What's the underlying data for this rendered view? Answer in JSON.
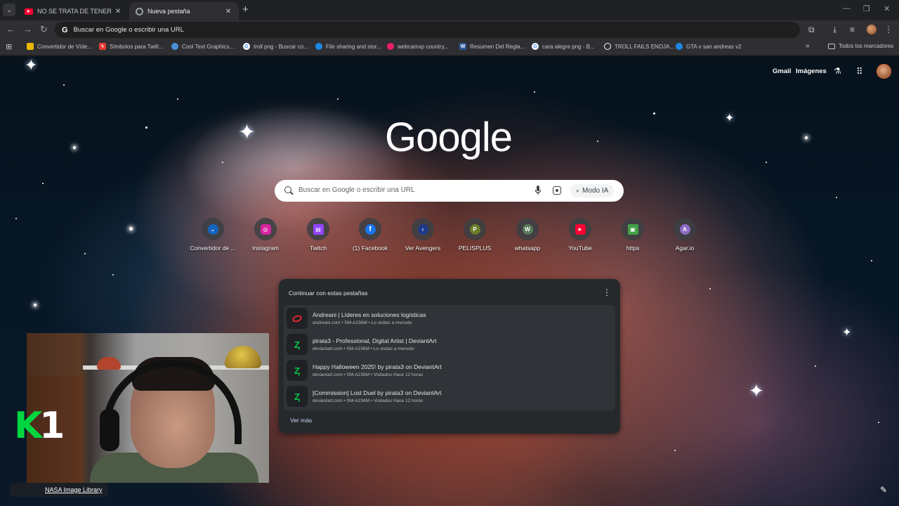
{
  "tabs": [
    {
      "title": "NO SE TRATA DE TENER EL PIN",
      "icon": "youtube-icon",
      "active": false
    },
    {
      "title": "Nueva pestaña",
      "icon": "chrome-icon",
      "active": true
    }
  ],
  "toolbar": {
    "omnibox_text": "Buscar en Google o escribir una URL",
    "omnibox_logo": "G"
  },
  "bookmarks": [
    {
      "label": "Convertidor de Víde...",
      "icon": "converter-icon",
      "color": "#e6b800"
    },
    {
      "label": "Símbolos para Twitt...",
      "icon": "lightning-icon",
      "color": "#e53935"
    },
    {
      "label": "Cool Text Graphics...",
      "icon": "cooltext-icon",
      "color": "#4a90d9"
    },
    {
      "label": "troll png - Buscar co...",
      "icon": "google-icon",
      "color": "#ffffff"
    },
    {
      "label": "File sharing and stor...",
      "icon": "mediafire-icon",
      "color": "#1e88e5"
    },
    {
      "label": "webcamxp country...",
      "icon": "webcam-icon",
      "color": "#e91e63"
    },
    {
      "label": "Resumen Del Regla...",
      "icon": "word-icon",
      "color": "#2b579a"
    },
    {
      "label": "cara alegre png - B...",
      "icon": "google-icon",
      "color": "#ffffff"
    },
    {
      "label": "TROLL FAILS ENOJA...",
      "icon": "chrome-icon",
      "color": "#ffffff"
    },
    {
      "label": "GTA v san andreas v2",
      "icon": "mediafire-icon",
      "color": "#1e88e5"
    }
  ],
  "bookmarks_all": "Todos los marcadores",
  "ntp": {
    "gmail": "Gmail",
    "images": "Imágenes",
    "logo": "Google",
    "search_placeholder": "Buscar en Google o escribir una URL",
    "ai_mode": "Modo IA",
    "shortcuts": [
      {
        "label": "Convertidor de ...",
        "icon": "converter-icon",
        "color": "#1565c0",
        "glyph": "⌄"
      },
      {
        "label": "Instagram",
        "icon": "instagram-icon",
        "color": "#d6249f",
        "glyph": "◎"
      },
      {
        "label": "Twitch",
        "icon": "twitch-icon",
        "color": "#9146ff",
        "glyph": "▤"
      },
      {
        "label": "(1) Facebook",
        "icon": "facebook-icon",
        "color": "#1877f2",
        "glyph": "f"
      },
      {
        "label": "Ver Avengers",
        "icon": "avengers-icon",
        "color": "#1e3a8a",
        "glyph": "⟨"
      },
      {
        "label": "PELISPLUS",
        "icon": "letter-p-icon",
        "color": "#6b7d2a",
        "glyph": "P"
      },
      {
        "label": "whatsapp",
        "icon": "letter-w-icon",
        "color": "#5a7a5a",
        "glyph": "W"
      },
      {
        "label": "YouTube",
        "icon": "youtube-icon",
        "color": "#ff0033",
        "glyph": "▶"
      },
      {
        "label": "https",
        "icon": "image-icon",
        "color": "#43a047",
        "glyph": "▣"
      },
      {
        "label": "Agar.io",
        "icon": "letter-a-icon",
        "color": "#8e6bc4",
        "glyph": "A"
      }
    ],
    "continue_card": {
      "title": "Continuar con estas pestañas",
      "items": [
        {
          "title": "Andreani | Líderes en soluciones logísticas",
          "subtitle": "andreani.com • SM-A236M • Lo visitas a menudo",
          "icon": "andreani-icon"
        },
        {
          "title": "pirata3 - Professional, Digital Artist | DeviantArt",
          "subtitle": "deviantart.com • SM-A236M • Lo visitas a menudo",
          "icon": "deviantart-icon"
        },
        {
          "title": "Happy Halloween 2025! by pirata3 on DeviantArt",
          "subtitle": "deviantart.com • SM-A236M • Visitados Hace 12 horas",
          "icon": "deviantart-icon"
        },
        {
          "title": "[Commission] Lost Duel by pirata3 on DeviantArt",
          "subtitle": "deviantart.com • SM-A236M • Visitados Hace 12 horas",
          "icon": "deviantart-icon"
        }
      ],
      "more": "Ver más"
    },
    "attribution": "NASA Image Library"
  },
  "overlay": {
    "logo_k": "K",
    "logo_1": "1"
  }
}
